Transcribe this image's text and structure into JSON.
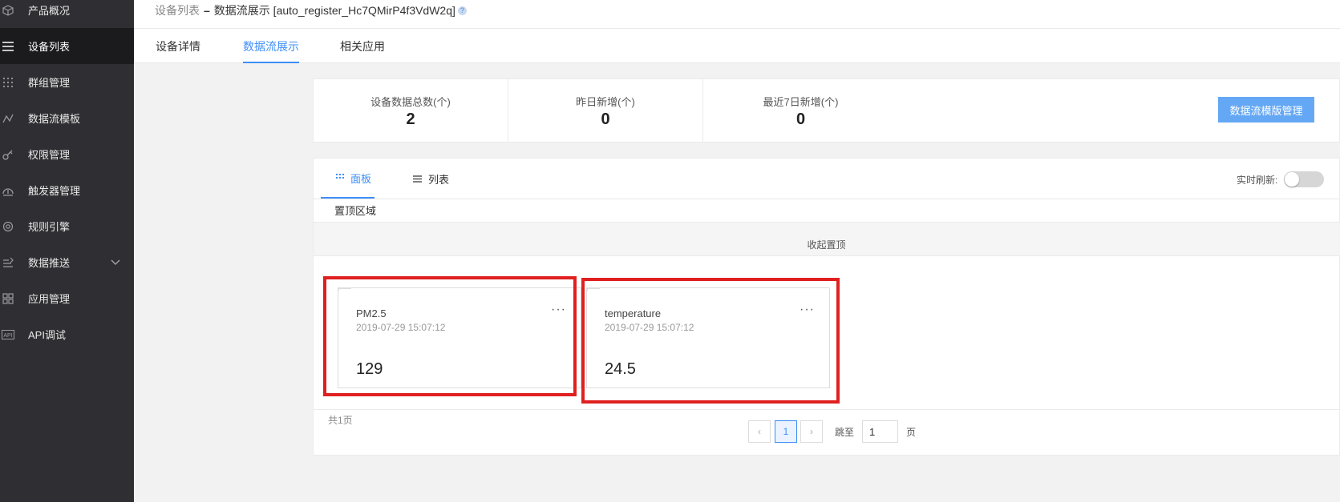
{
  "sidebar": {
    "items": [
      {
        "label": "产品概况",
        "icon": "cube-icon"
      },
      {
        "label": "设备列表",
        "icon": "list-icon",
        "active": true
      },
      {
        "label": "群组管理",
        "icon": "grid-dots-icon"
      },
      {
        "label": "数据流模板",
        "icon": "line-chart-icon"
      },
      {
        "label": "权限管理",
        "icon": "key-icon"
      },
      {
        "label": "触发器管理",
        "icon": "gauge-icon"
      },
      {
        "label": "规则引擎",
        "icon": "engine-icon"
      },
      {
        "label": "数据推送",
        "icon": "push-icon",
        "has_chevron": true
      },
      {
        "label": "应用管理",
        "icon": "apps-icon"
      },
      {
        "label": "API调试",
        "icon": "api-icon"
      }
    ]
  },
  "breadcrumb": {
    "parent": "设备列表",
    "separator": "–",
    "current": "数据流展示 [auto_register_Hc7QMirP4f3VdW2q]",
    "help": "?"
  },
  "tabs": [
    {
      "label": "设备详情"
    },
    {
      "label": "数据流展示",
      "active": true
    },
    {
      "label": "相关应用"
    }
  ],
  "stats": [
    {
      "label": "设备数据总数(个)",
      "value": "2"
    },
    {
      "label": "昨日新增(个)",
      "value": "0"
    },
    {
      "label": "最近7日新增(个)",
      "value": "0"
    }
  ],
  "template_button": "数据流模版管理",
  "view_tabs": {
    "panel": "面板",
    "list": "列表"
  },
  "realtime_label": "实时刷新:",
  "pinned": {
    "label": "置顶区域",
    "collapse": "收起置顶"
  },
  "cards": [
    {
      "name": "PM2.5",
      "time": "2019-07-29 15:07:12",
      "value": "129",
      "more": "···"
    },
    {
      "name": "temperature",
      "time": "2019-07-29 15:07:12",
      "value": "24.5",
      "more": "···"
    }
  ],
  "pagination": {
    "total": "共1页",
    "prev": "‹",
    "current": "1",
    "next": "›",
    "jump_label": "跳至",
    "jump_value": "1",
    "unit": "页"
  },
  "colors": {
    "accent": "#3e8ef7",
    "sidebar_bg": "#2f2f33",
    "highlight": "#e02020"
  }
}
